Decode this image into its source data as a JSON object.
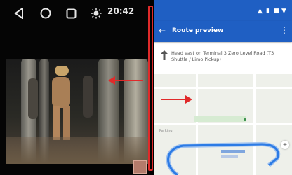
{
  "left": {
    "time": "20:42"
  },
  "right": {
    "app_bar": {
      "title": "Route preview"
    },
    "step": {
      "text": "Head east on Terminal 3 Zero Level Road (T3 Shuttle / Limo Pickup)"
    },
    "map": {
      "parking_label": "Parking"
    }
  },
  "colors": {
    "accent": "#1f5fc3",
    "annotation_red": "#e02a2a",
    "route": "#2c7be5"
  },
  "icons": [
    "back-icon",
    "home-icon",
    "recents-icon",
    "brightness-icon",
    "turn-arrow-icon",
    "more-icon",
    "location-dot-icon"
  ]
}
